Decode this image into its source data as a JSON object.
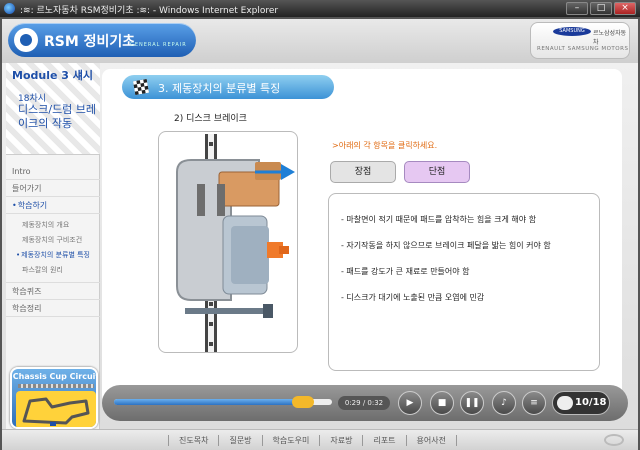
{
  "window": {
    "title": ":≋: 르노자동차 RSM정비기초 :≋: - Windows Internet Explorer",
    "controls": [
      "–",
      "□",
      "×"
    ]
  },
  "header": {
    "logo_title": "RSM 정비기초",
    "logo_sub": "GENERAL REPAIR",
    "brand_samsung": "SAMSUNG",
    "brand_ko": "르노삼성자동차",
    "brand_en": "RENAULT SAMSUNG MOTORS"
  },
  "sidebar": {
    "module_title": "Module 3 섀시",
    "session": "18차시",
    "topic": "디스크/드럼 브레이크의 작동",
    "nav": [
      {
        "label": "Intro"
      },
      {
        "label": "들어가기"
      },
      {
        "label": "학습하기",
        "active": true
      },
      {
        "label": "학습퀴즈"
      },
      {
        "label": "학습정리"
      }
    ],
    "subnav": [
      "제동장치의 개요",
      "제동장치의 구비조건",
      "제동장치의 분류별 특징",
      "파스칼의 원리"
    ],
    "current_subnav": "제동장치의 분류별 특징",
    "chassis_title": "Chassis Cup Circuit"
  },
  "content": {
    "section_title": "3. 제동장치의 분류별 특징",
    "subheading": "2) 디스크 브레이크",
    "hint": ">아래의 각 항목을 클릭하세요.",
    "tabs": [
      {
        "label": "장점",
        "selected": false
      },
      {
        "label": "단점",
        "selected": true
      }
    ],
    "details": [
      "- 마찰면이 적기 때문에 패드를 압착하는 힘을 크게 해야 함",
      "- 자기작동을 하지 않으므로 브레이크 페달을 밟는 힘이 커야 함",
      "- 패드를 강도가 큰 재료로 만들어야 함",
      "- 디스크가 대기에 노출된 만큼 오염에 민감"
    ]
  },
  "player": {
    "time": "0:29 / 0:32",
    "progress": 0.906,
    "page": "10/18"
  },
  "footer": {
    "links": [
      "진도목차",
      "질문방",
      "학습도우미",
      "자료방",
      "리포트",
      "용어사전"
    ]
  },
  "colors": {
    "accent_blue": "#1e4fa8",
    "tab_selected": "#e6c8f2",
    "hint_orange": "#e06a10",
    "thumb_yellow": "#f3b82a"
  }
}
